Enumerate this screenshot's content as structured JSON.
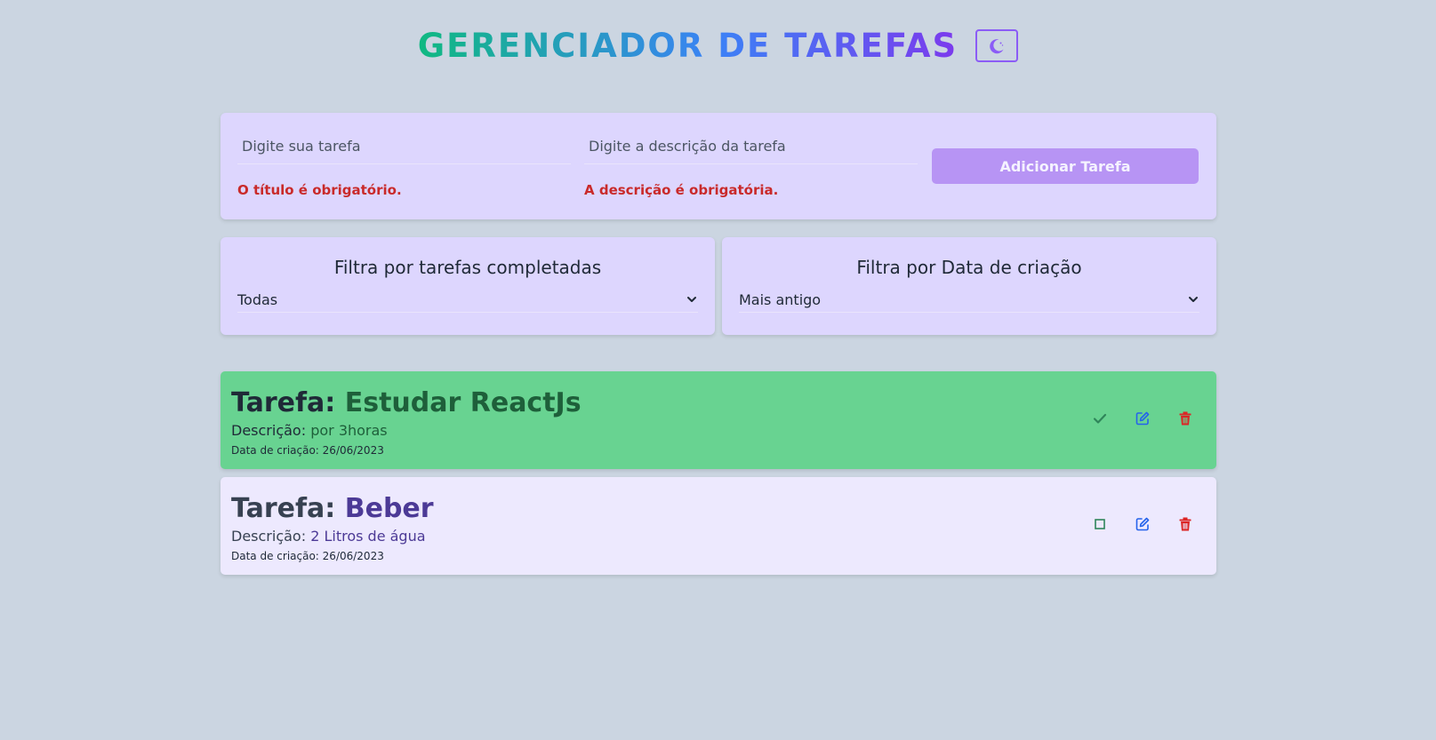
{
  "header": {
    "title": "GERENCIADOR DE TAREFAS",
    "theme_icon": "moon-icon"
  },
  "form": {
    "title_input": {
      "value": "",
      "placeholder": "Digite sua tarefa"
    },
    "description_input": {
      "value": "",
      "placeholder": "Digite a descrição da tarefa"
    },
    "title_error": "O título é obrigatório.",
    "description_error": "A descrição é obrigatória.",
    "add_button_label": "Adicionar Tarefa"
  },
  "filters": {
    "completed": {
      "label": "Filtra por tarefas completadas",
      "selected": "Todas"
    },
    "date": {
      "label": "Filtra por Data de criação",
      "selected": "Mais antigo"
    }
  },
  "tasks": [
    {
      "title_label": "Tarefa:",
      "title": "Estudar ReactJs",
      "description_label": "Descrição:",
      "description": "por 3horas",
      "date_label": "Data de criação:",
      "date": "26/06/2023",
      "completed": true,
      "status_icon": "check-icon"
    },
    {
      "title_label": "Tarefa:",
      "title": "Beber",
      "description_label": "Descrição:",
      "description": "2 Litros de água",
      "date_label": "Data de criação:",
      "date": "26/06/2023",
      "completed": false,
      "status_icon": "checkbox-empty-icon"
    }
  ],
  "colors": {
    "background": "#cbd5e1",
    "card": "#ddd6fe",
    "completed_task": "#68d391",
    "pending_task": "#ede9fe",
    "error": "#c92a2a",
    "accent": "#8b5cf6",
    "edit_icon": "#2563eb",
    "delete_icon": "#dc2626"
  }
}
